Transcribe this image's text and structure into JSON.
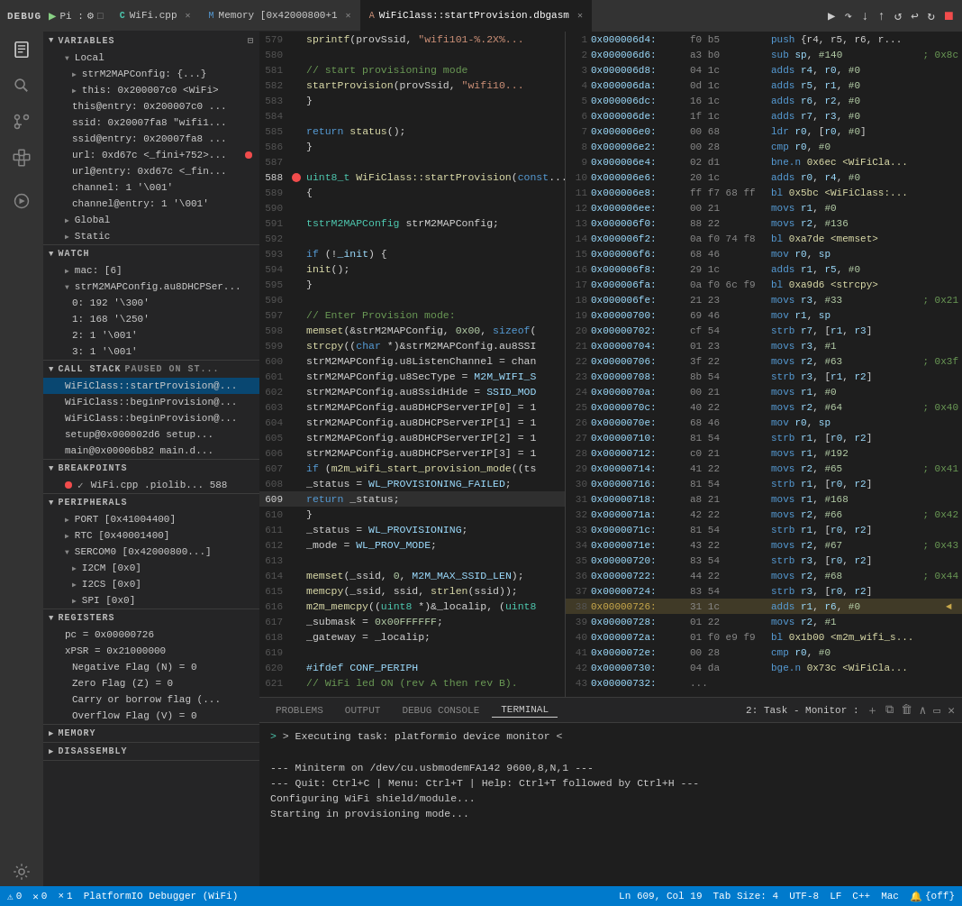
{
  "topBar": {
    "debug": "DEBUG",
    "pi": "Pi :",
    "tabs": [
      {
        "id": "wifi-cpp",
        "icon": "C",
        "label": "WiFi.cpp",
        "active": true,
        "modified": false
      },
      {
        "id": "memory",
        "icon": "M",
        "label": "Memory [0x42000800+1",
        "active": false,
        "modified": false
      },
      {
        "id": "wificlass-asm",
        "icon": "A",
        "label": "WiFiClass::startProvision.dbgasm",
        "active": false,
        "modified": false
      }
    ],
    "debugActions": [
      "⏵",
      "⏸",
      "⏬",
      "⏭",
      "⏪",
      "↩",
      "↻",
      "⏹"
    ]
  },
  "sidebar": {
    "sections": {
      "variables": {
        "title": "VARIABLES",
        "locals": {
          "title": "Local",
          "items": [
            {
              "label": "strM2MAPConfig: {...}",
              "indent": 1
            },
            {
              "label": "this: 0x200007c0 <WiFi>",
              "indent": 2
            },
            {
              "label": "this@entry: 0x200007c0 ...",
              "indent": 2
            },
            {
              "label": "ssid: 0x20007fa8 \"wifi1...",
              "indent": 2
            },
            {
              "label": "ssid@entry: 0x20007fa8 ...",
              "indent": 2
            },
            {
              "label": "url: 0xd67c <_fini+752>...",
              "indent": 2,
              "hasDot": true
            },
            {
              "label": "url@entry: 0xd67c <_fin...",
              "indent": 2
            },
            {
              "label": "channel: 1 '\\001'",
              "indent": 2
            },
            {
              "label": "channel@entry: 1 '\\001'",
              "indent": 2
            }
          ]
        },
        "global": {
          "title": "Global"
        },
        "static": {
          "title": "Static"
        }
      },
      "watch": {
        "title": "WATCH",
        "items": [
          {
            "label": "mac: [6]"
          },
          {
            "label": "strM2MAPConfig.au8DHCPSer...",
            "expanded": true
          },
          {
            "label": "0: 192 '\\300'",
            "indent": 2
          },
          {
            "label": "1: 168 '\\250'",
            "indent": 2
          },
          {
            "label": "2: 1 '\\001'",
            "indent": 2
          },
          {
            "label": "3: 1 '\\001'",
            "indent": 2
          }
        ]
      },
      "callStack": {
        "title": "CALL STACK",
        "subtitle": "PAUSED ON ST...",
        "items": [
          {
            "label": "WiFiClass::startProvision@..."
          },
          {
            "label": "WiFiClass::beginProvision@..."
          },
          {
            "label": "WiFiClass::beginProvision@..."
          },
          {
            "label": "setup@0x000002d6  setup..."
          },
          {
            "label": "main@0x00006b82  main.d..."
          }
        ]
      },
      "breakpoints": {
        "title": "BREAKPOINTS",
        "items": [
          {
            "label": "WiFi.cpp  .piolib...  588",
            "hasRedDot": true,
            "hasCheck": true
          }
        ]
      },
      "peripherals": {
        "title": "PERIPHERALS",
        "items": [
          {
            "label": "PORT [0x41004400]",
            "indent": 1
          },
          {
            "label": "RTC [0x40001400]",
            "indent": 1
          },
          {
            "label": "SERCOM0 [0x42000800...]",
            "indent": 1,
            "expanded": true
          },
          {
            "label": "I2CM [0x0]",
            "indent": 2
          },
          {
            "label": "I2CS [0x0]",
            "indent": 2
          },
          {
            "label": "SPI [0x0]",
            "indent": 2
          }
        ]
      },
      "registers": {
        "title": "REGISTERS",
        "items": [
          {
            "label": "pc = 0x00000726"
          },
          {
            "label": "xPSR = 0x21000000"
          },
          {
            "label": "Negative Flag (N) = 0"
          },
          {
            "label": "Zero Flag (Z) = 0"
          },
          {
            "label": "Carry or borrow flag (..."
          },
          {
            "label": "Overflow Flag (V) = 0"
          }
        ]
      },
      "memory": {
        "title": "MEMORY"
      },
      "disassembly": {
        "title": "DISASSEMBLY"
      }
    }
  },
  "codeEditor": {
    "lines": [
      {
        "num": 579,
        "content": "    sprintf(provSsid, \"wifi101-%.2X%...",
        "type": "plain"
      },
      {
        "num": 580,
        "content": "",
        "type": "plain"
      },
      {
        "num": 581,
        "content": "    // start provisioning mode",
        "type": "comment"
      },
      {
        "num": 582,
        "content": "    startProvision(provSsid, \"wifi10...",
        "type": "plain"
      },
      {
        "num": 583,
        "content": "  }",
        "type": "plain"
      },
      {
        "num": 584,
        "content": "",
        "type": "plain"
      },
      {
        "num": 585,
        "content": "  return status();",
        "type": "plain"
      },
      {
        "num": 586,
        "content": "}",
        "type": "plain"
      },
      {
        "num": 587,
        "content": "",
        "type": "plain"
      },
      {
        "num": 588,
        "content": "uint8_t WiFiClass::startProvision(const...",
        "type": "bp",
        "hasBreakpoint": true
      },
      {
        "num": 589,
        "content": "{",
        "type": "plain"
      },
      {
        "num": 590,
        "content": "",
        "type": "plain"
      },
      {
        "num": 591,
        "content": "  tstrM2MAPConfig strM2MAPConfig;",
        "type": "plain"
      },
      {
        "num": 592,
        "content": "",
        "type": "plain"
      },
      {
        "num": 593,
        "content": "  if (!_init) {",
        "type": "plain"
      },
      {
        "num": 594,
        "content": "    init();",
        "type": "plain"
      },
      {
        "num": 595,
        "content": "  }",
        "type": "plain"
      },
      {
        "num": 596,
        "content": "",
        "type": "plain"
      },
      {
        "num": 597,
        "content": "  // Enter Provision mode:",
        "type": "comment"
      },
      {
        "num": 598,
        "content": "  memset(&strM2MAPConfig, 0x00, sizeof(",
        "type": "plain"
      },
      {
        "num": 599,
        "content": "  strcpy((char *)&strM2MAPConfig.au8SSI",
        "type": "plain"
      },
      {
        "num": 600,
        "content": "  strM2MAPConfig.u8ListenChannel = chan",
        "type": "plain"
      },
      {
        "num": 601,
        "content": "  strM2MAPConfig.u8SecType = M2M_WIFI_S",
        "type": "plain"
      },
      {
        "num": 602,
        "content": "  strM2MAPConfig.au8SsidHide = SSID_MOD",
        "type": "plain"
      },
      {
        "num": 603,
        "content": "  strM2MAPConfig.au8DHCPServerIP[0] = 1",
        "type": "plain"
      },
      {
        "num": 604,
        "content": "  strM2MAPConfig.au8DHCPServerIP[1] = 1",
        "type": "plain"
      },
      {
        "num": 605,
        "content": "  strM2MAPConfig.au8DHCPServerIP[2] = 1",
        "type": "plain"
      },
      {
        "num": 606,
        "content": "  strM2MAPConfig.au8DHCPServerIP[3] = 1",
        "type": "plain"
      },
      {
        "num": 607,
        "content": "  if (m2m_wifi_start_provision_mode((ts",
        "type": "plain"
      },
      {
        "num": 608,
        "content": "    _status = WL_PROVISIONING_FAILED;",
        "type": "plain"
      },
      {
        "num": 609,
        "content": "    return _status;",
        "type": "plain"
      },
      {
        "num": 610,
        "content": "  }",
        "type": "plain"
      },
      {
        "num": 611,
        "content": "  _status = WL_PROVISIONING;",
        "type": "plain"
      },
      {
        "num": 612,
        "content": "  _mode = WL_PROV_MODE;",
        "type": "plain"
      },
      {
        "num": 613,
        "content": "",
        "type": "plain"
      },
      {
        "num": 614,
        "content": "  memset(_ssid, 0, M2M_MAX_SSID_LEN);",
        "type": "plain"
      },
      {
        "num": 615,
        "content": "  memcpy(_ssid, ssid, strlen(ssid));",
        "type": "plain"
      },
      {
        "num": 616,
        "content": "  m2m_memcpy((uint8 *)&_localip, (uint8",
        "type": "plain"
      },
      {
        "num": 617,
        "content": "  _submask = 0x00FFFFFF;",
        "type": "plain"
      },
      {
        "num": 618,
        "content": "  _gateway = _localip;",
        "type": "plain"
      },
      {
        "num": 619,
        "content": "",
        "type": "plain"
      },
      {
        "num": 620,
        "content": "#ifdef  CONF_PERIPH",
        "type": "macro"
      },
      {
        "num": 621,
        "content": "  // WiFi led ON (rev A then rev B).",
        "type": "comment"
      }
    ]
  },
  "asmPanel": {
    "title": "WiFiClass::startProvision.dbgasm",
    "lines": [
      {
        "idx": 1,
        "addr": "0x000006d4:",
        "bytes": "f0 b5",
        "instr": "push",
        "args": "{r4, r5, r6, r...",
        "comment": ""
      },
      {
        "idx": 2,
        "addr": "0x000006d6:",
        "bytes": "a3 b0",
        "instr": "sub",
        "args": "sp, #140",
        "comment": "; 0x8c"
      },
      {
        "idx": 3,
        "addr": "0x000006d8:",
        "bytes": "04 1c",
        "instr": "adds",
        "args": "r4, r0, #0",
        "comment": ""
      },
      {
        "idx": 4,
        "addr": "0x000006da:",
        "bytes": "0d 1c",
        "instr": "adds",
        "args": "r5, r1, #0",
        "comment": ""
      },
      {
        "idx": 5,
        "addr": "0x000006dc:",
        "bytes": "16 1c",
        "instr": "adds",
        "args": "r6, r2, #0",
        "comment": ""
      },
      {
        "idx": 6,
        "addr": "0x000006de:",
        "bytes": "1f 1c",
        "instr": "adds",
        "args": "r7, r3, #0",
        "comment": ""
      },
      {
        "idx": 7,
        "addr": "0x000006e0:",
        "bytes": "00 68",
        "instr": "ldr",
        "args": "r0, [r0, #0]",
        "comment": ""
      },
      {
        "idx": 8,
        "addr": "0x000006e2:",
        "bytes": "00 28",
        "instr": "cmp",
        "args": "r0, #0",
        "comment": ""
      },
      {
        "idx": 9,
        "addr": "0x000006e4:",
        "bytes": "02 d1",
        "instr": "bne.n",
        "args": "0x6ec <WiFiCla...",
        "comment": ""
      },
      {
        "idx": 10,
        "addr": "0x000006e6:",
        "bytes": "20 1c",
        "instr": "adds",
        "args": "r0, r4, #0",
        "comment": ""
      },
      {
        "idx": 11,
        "addr": "0x000006e8:",
        "bytes": "ff f7 68 ff",
        "instr": "bl",
        "args": "0x5bc <WiFiClass:...",
        "comment": ""
      },
      {
        "idx": 12,
        "addr": "0x000006ee:",
        "bytes": "00 21",
        "instr": "movs",
        "args": "r1, #0",
        "comment": ""
      },
      {
        "idx": 13,
        "addr": "0x000006f0:",
        "bytes": "88 22",
        "instr": "movs",
        "args": "r2, #136",
        "comment": ""
      },
      {
        "idx": 14,
        "addr": "0x000006f2:",
        "bytes": "0a f0 74 f8",
        "instr": "bl",
        "args": "0xa7de <memset>",
        "comment": ""
      },
      {
        "idx": 15,
        "addr": "0x000006f6:",
        "bytes": "68 46",
        "instr": "mov",
        "args": "r0, sp",
        "comment": ""
      },
      {
        "idx": 16,
        "addr": "0x000006f8:",
        "bytes": "29 1c",
        "instr": "adds",
        "args": "r1, r5, #0",
        "comment": ""
      },
      {
        "idx": 17,
        "addr": "0x000006fa:",
        "bytes": "0a f0 6c f9",
        "instr": "bl",
        "args": "0xa9d6 <strcpy>",
        "comment": ""
      },
      {
        "idx": 18,
        "addr": "0x000006fe:",
        "bytes": "21 23",
        "instr": "movs",
        "args": "r3, #33",
        "comment": "; 0x21"
      },
      {
        "idx": 19,
        "addr": "0x00000700:",
        "bytes": "69 46",
        "instr": "mov",
        "args": "r1, sp",
        "comment": ""
      },
      {
        "idx": 20,
        "addr": "0x00000702:",
        "bytes": "cf 54",
        "instr": "strb",
        "args": "r7, [r1, r3]",
        "comment": ""
      },
      {
        "idx": 21,
        "addr": "0x00000704:",
        "bytes": "01 23",
        "instr": "movs",
        "args": "r3, #1",
        "comment": ""
      },
      {
        "idx": 22,
        "addr": "0x00000706:",
        "bytes": "3f 22",
        "instr": "movs",
        "args": "r2, #63",
        "comment": "; 0x3f"
      },
      {
        "idx": 23,
        "addr": "0x00000708:",
        "bytes": "8b 54",
        "instr": "strb",
        "args": "r3, [r1, r2]",
        "comment": ""
      },
      {
        "idx": 24,
        "addr": "0x0000070a:",
        "bytes": "00 21",
        "instr": "movs",
        "args": "r1, #0",
        "comment": ""
      },
      {
        "idx": 25,
        "addr": "0x0000070c:",
        "bytes": "40 22",
        "instr": "movs",
        "args": "r2, #64",
        "comment": "; 0x40"
      },
      {
        "idx": 26,
        "addr": "0x0000070e:",
        "bytes": "68 46",
        "instr": "mov",
        "args": "r0, sp",
        "comment": ""
      },
      {
        "idx": 27,
        "addr": "0x00000710:",
        "bytes": "81 54",
        "instr": "strb",
        "args": "r1, [r0, r2]",
        "comment": ""
      },
      {
        "idx": 28,
        "addr": "0x00000712:",
        "bytes": "c0 21",
        "instr": "movs",
        "args": "r1, #192",
        "comment": ""
      },
      {
        "idx": 29,
        "addr": "0x00000714:",
        "bytes": "41 22",
        "instr": "movs",
        "args": "r2, #65",
        "comment": "; 0x41"
      },
      {
        "idx": 30,
        "addr": "0x00000716:",
        "bytes": "81 54",
        "instr": "strb",
        "args": "r1, [r0, r2]",
        "comment": ""
      },
      {
        "idx": 31,
        "addr": "0x00000718:",
        "bytes": "a8 21",
        "instr": "movs",
        "args": "r1, #168",
        "comment": ""
      },
      {
        "idx": 32,
        "addr": "0x0000071a:",
        "bytes": "42 22",
        "instr": "movs",
        "args": "r2, #66",
        "comment": "; 0x42"
      },
      {
        "idx": 33,
        "addr": "0x0000071c:",
        "bytes": "81 54",
        "instr": "strb",
        "args": "r1, [r0, r2]",
        "comment": ""
      },
      {
        "idx": 34,
        "addr": "0x0000071e:",
        "bytes": "43 22",
        "instr": "movs",
        "args": "r2, #67",
        "comment": "; 0x43"
      },
      {
        "idx": 35,
        "addr": "0x00000720:",
        "bytes": "83 54",
        "instr": "strb",
        "args": "r3, [r0, r2]",
        "comment": ""
      },
      {
        "idx": 36,
        "addr": "0x00000722:",
        "bytes": "44 22",
        "instr": "movs",
        "args": "r2, #68",
        "comment": "; 0x44"
      },
      {
        "idx": 37,
        "addr": "0x00000724:",
        "bytes": "83 54",
        "instr": "strb",
        "args": "r3, [r0, r2]",
        "comment": ""
      },
      {
        "idx": 38,
        "addr": "0x00000726:",
        "bytes": "31 1c",
        "instr": "adds",
        "args": "r1, r6, #0",
        "comment": "",
        "current": true
      },
      {
        "idx": 39,
        "addr": "0x00000728:",
        "bytes": "01 22",
        "instr": "movs",
        "args": "r2, #1",
        "comment": ""
      },
      {
        "idx": 40,
        "addr": "0x0000072a:",
        "bytes": "01 f0 e9 f9",
        "instr": "bl",
        "args": "0x1b00 <m2m_wifi_s...",
        "comment": ""
      },
      {
        "idx": 41,
        "addr": "0x0000072e:",
        "bytes": "00 28",
        "instr": "cmp",
        "args": "r0, #0",
        "comment": ""
      },
      {
        "idx": 42,
        "addr": "0x00000730:",
        "bytes": "04 da",
        "instr": "bge.n",
        "args": "0x73c <WiFiCla...",
        "comment": ""
      },
      {
        "idx": 43,
        "addr": "0x00000732:",
        "bytes": "...",
        "instr": "",
        "args": "",
        "comment": ""
      }
    ]
  },
  "terminal": {
    "tabs": [
      "PROBLEMS",
      "OUTPUT",
      "DEBUG CONSOLE",
      "TERMINAL"
    ],
    "activeTab": "TERMINAL",
    "taskLabel": "2: Task - Monitor :",
    "content": [
      "> Executing task: platformio device monitor <",
      "",
      "--- Miniterm on /dev/cu.usbmodemFA142  9600,8,N,1 ---",
      "--- Quit: Ctrl+C | Menu: Ctrl+T | Help: Ctrl+T followed by Ctrl+H ---",
      "Configuring WiFi shield/module...",
      "Starting in provisioning mode..."
    ]
  },
  "statusBar": {
    "warnings": "⚠ 0",
    "errors": "✕ 0",
    "debugger": "× 1",
    "platformio": "PlatformIO Debugger (WiFi)",
    "lnCol": "Ln 609, Col 19",
    "tabSize": "Tab Size: 4",
    "encoding": "UTF-8",
    "lineEnding": "LF",
    "language": "C++",
    "platform": "Mac",
    "notification": "{off}"
  }
}
